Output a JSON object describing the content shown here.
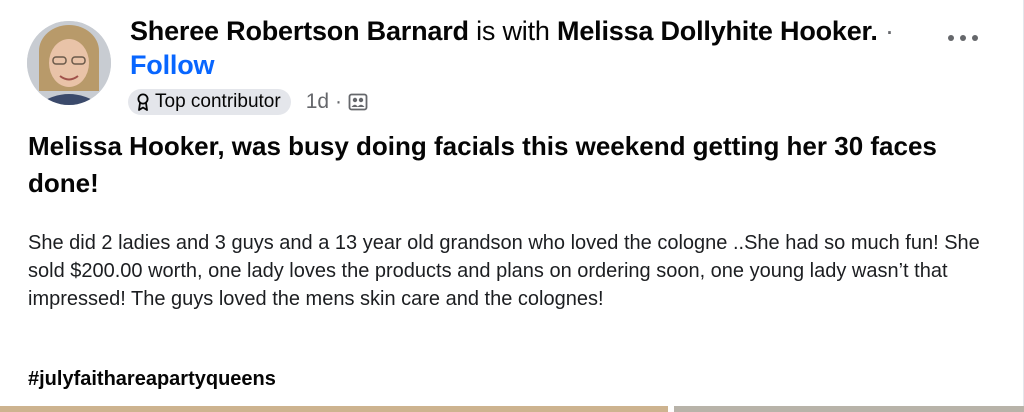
{
  "post": {
    "author": "Sheree Robertson Barnard",
    "with_text": "is with",
    "tagged": "Melissa Dollyhite Hooker.",
    "separator": "·",
    "follow_label": "Follow",
    "badge": {
      "label": "Top contributor",
      "icon": "award-icon"
    },
    "time": "1d",
    "meta_separator": "·",
    "audience_icon": "friends-icon",
    "more_icon": "more-options-icon",
    "title": "Melissa Hooker, was busy doing facials this weekend getting her 30 faces done!",
    "body": "She did 2 ladies and 3 guys and a 13 year old grandson who loved  the cologne ..She had so much fun! She sold  $200.00 worth, one lady loves the products and plans on ordering soon, one young lady wasn’t that impressed! The guys loved  the mens skin care and the colognes!",
    "hashtag": "#julyfaithareapartyqueens"
  },
  "colors": {
    "link": "#0866ff",
    "secondary_text": "#65676b",
    "badge_bg": "#e4e6eb"
  }
}
